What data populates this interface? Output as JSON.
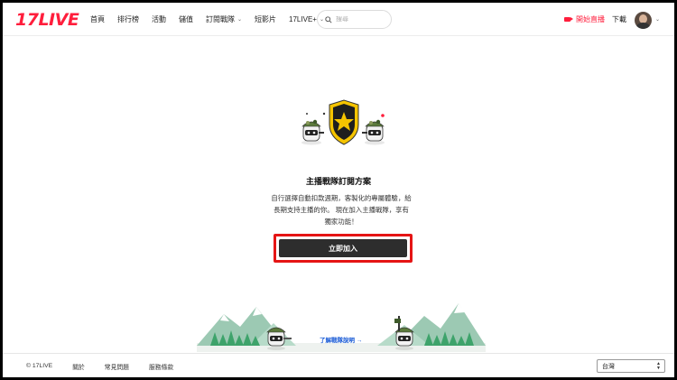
{
  "header": {
    "logo": "17LIVE",
    "nav": [
      {
        "label": "首頁",
        "dropdown": false
      },
      {
        "label": "排行榜",
        "dropdown": false
      },
      {
        "label": "活動",
        "dropdown": false
      },
      {
        "label": "儲值",
        "dropdown": false
      },
      {
        "label": "訂閱戰隊",
        "dropdown": true
      },
      {
        "label": "短影片",
        "dropdown": false
      },
      {
        "label": "17LIVE+",
        "dropdown": true
      }
    ],
    "search_placeholder": "搜尋",
    "go_live_label": "開始直播",
    "download_label": "下載"
  },
  "main": {
    "title": "主播戰隊訂閱方案",
    "description": "自行選擇自動扣款週期，客製化的專屬體驗，給長期支持主播的你。 現在加入主播戰隊，享有獨家功能！",
    "join_button": "立即加入",
    "learn_more": "了解戰隊說明 →"
  },
  "footer": {
    "copyright": "© 17LIVE",
    "links": [
      "關於",
      "常見問題",
      "服務條款"
    ],
    "region": "台灣"
  },
  "colors": {
    "brand": "#ff1e3c",
    "button_dark": "#2d2d2d",
    "highlight_border": "#e51515",
    "link": "#1a5bd6"
  },
  "icons": [
    "search-icon",
    "camera-icon",
    "chevron-down-icon",
    "shield-star-icon",
    "mountain-scene"
  ]
}
